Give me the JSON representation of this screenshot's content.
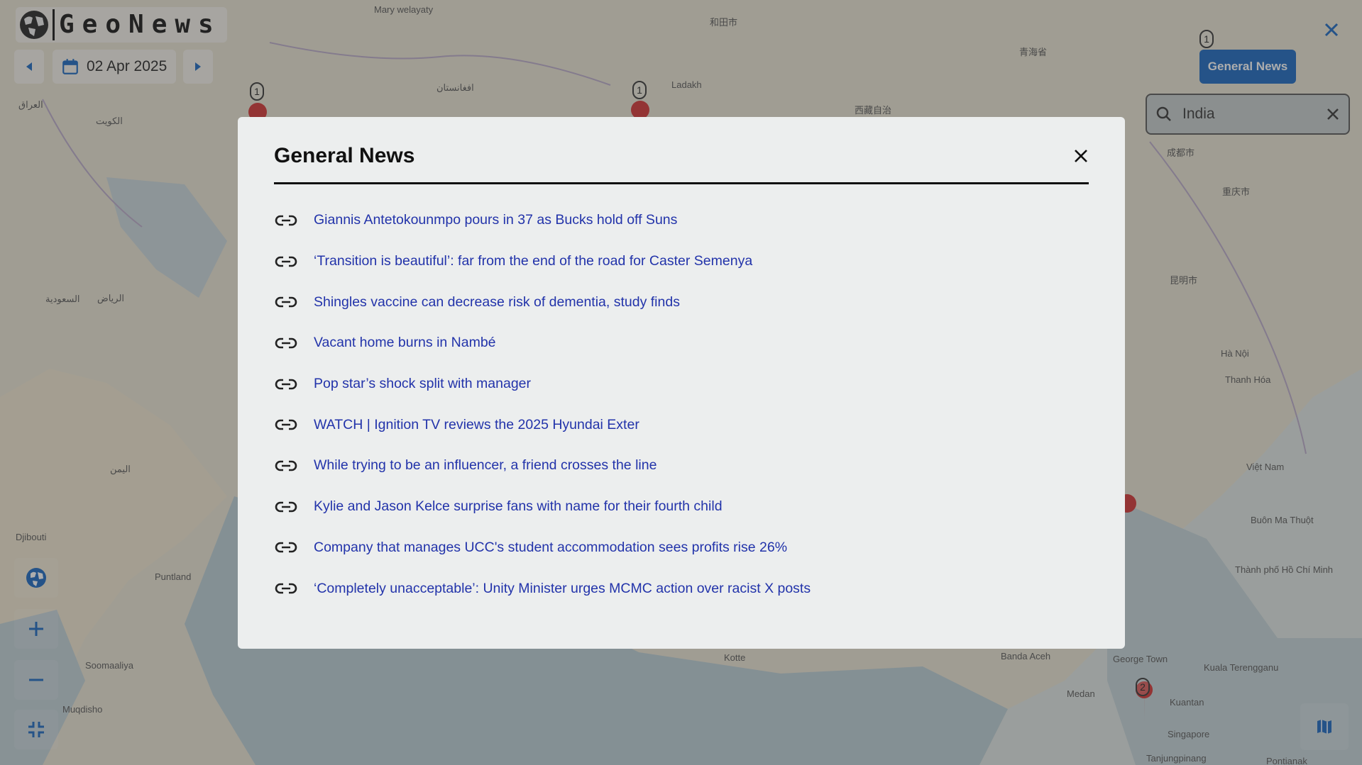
{
  "app": {
    "logo_text": "GeoNews"
  },
  "date": {
    "value": "02 Apr 2025"
  },
  "topbar": {
    "general_news_label": "General News"
  },
  "search": {
    "value": "India"
  },
  "modal": {
    "title": "General News",
    "items": [
      "Giannis Antetokounmpo pours in 37 as Bucks hold off Suns",
      "‘Transition is beautiful’: far from the end of the road for Caster Semenya",
      "Shingles vaccine can decrease risk of dementia, study finds",
      "Vacant home burns in Nambé",
      "Pop star’s shock split with manager",
      "WATCH | Ignition TV reviews the 2025 Hyundai Exter",
      "While trying to be an influencer, a friend crosses the line",
      "Kylie and Jason Kelce surprise fans with name for their fourth child",
      "Company that manages UCC's student accommodation sees profits rise 26%",
      "‘Completely unacceptable’: Unity Minister urges MCMC action over racist X posts"
    ]
  },
  "map": {
    "labels": [
      "Mary welayaty",
      "افغانستان",
      "Ladakh",
      "和田市",
      "青海省",
      "西藏自治",
      "العراق",
      "الكويت",
      "السعودية",
      "الرياض",
      "اليمن",
      "Djibouti",
      "Soomaaliya",
      "Muqdisho",
      "Puntland",
      "Kotte",
      "Banda Aceh",
      "Medan",
      "George Town",
      "Kuala Terengganu",
      "Kuantan",
      "Singapore",
      "Tanjungpinang",
      "Pontianak",
      "Hà Nội",
      "Việt Nam",
      "Thành phố Hồ Chí Minh",
      "Buôn Ma Thuột",
      "Thanh Hóa",
      "成都市",
      "重庆市",
      "昆明市"
    ],
    "pin_counts": [
      "1",
      "1",
      "1",
      "2"
    ]
  },
  "colors": {
    "accent": "#1565c0",
    "link": "#2233aa",
    "pin": "#d32f2f"
  }
}
